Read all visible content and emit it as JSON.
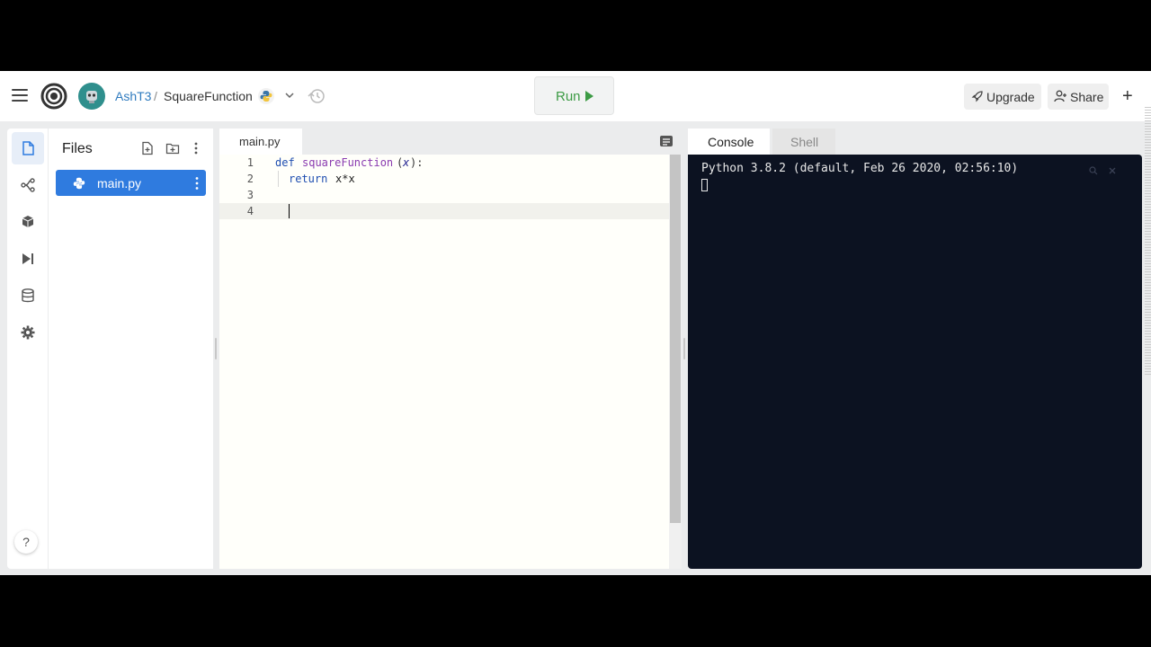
{
  "header": {
    "user": "AshT3",
    "separator": "/",
    "repl_name": "SquareFunction",
    "run_label": "Run",
    "upgrade_label": "Upgrade",
    "share_label": "Share",
    "add_label": "+"
  },
  "files": {
    "title": "Files",
    "items": [
      {
        "name": "main.py"
      }
    ]
  },
  "editor": {
    "active_tab": "main.py",
    "line_numbers": [
      "1",
      "2",
      "3",
      "4"
    ],
    "line1": {
      "kw": "def",
      "fn": "squareFunction",
      "open": "(",
      "param": "x",
      "close": "):"
    },
    "line2": {
      "kw": "return",
      "expr": "x*x"
    }
  },
  "console": {
    "tabs": [
      "Console",
      "Shell"
    ],
    "output": "Python 3.8.2 (default, Feb 26 2020, 02:56:10)"
  },
  "colors": {
    "accent": "#2f7bdf",
    "run_green": "#3d9b45",
    "terminal_bg": "#0c1221"
  }
}
